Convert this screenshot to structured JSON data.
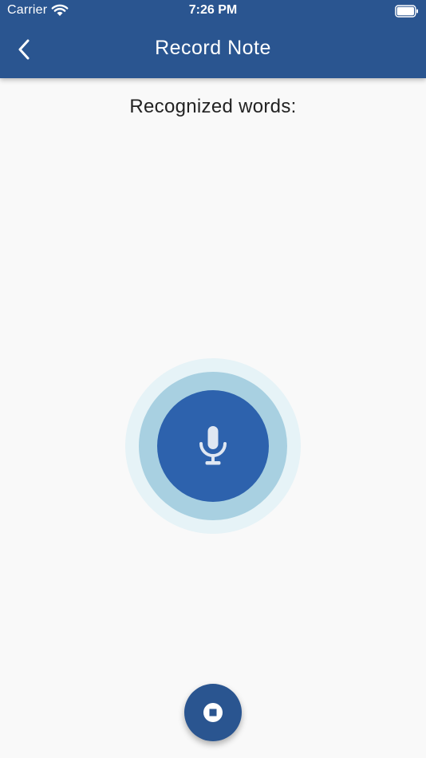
{
  "status_bar": {
    "carrier": "Carrier",
    "time": "7:26 PM"
  },
  "app_bar": {
    "title": "Record Note"
  },
  "content": {
    "recognized_label": "Recognized words:"
  },
  "colors": {
    "primary": "#2a5590",
    "mic_button": "#2d62ad",
    "ring_mid": "#a8d0e1",
    "ring_outer": "#e6f3f7",
    "background": "#f9f9f9"
  },
  "icons": {
    "back": "chevron-left-icon",
    "mic": "microphone-icon",
    "stop": "stop-icon",
    "wifi": "wifi-icon",
    "battery": "battery-icon"
  }
}
